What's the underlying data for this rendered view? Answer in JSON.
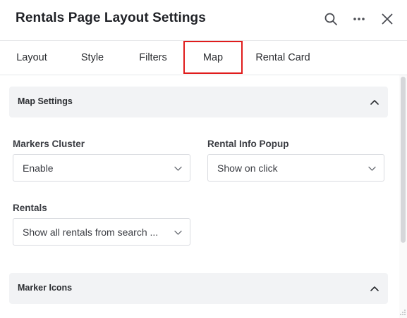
{
  "header": {
    "title": "Rentals Page Layout Settings",
    "icons": [
      "search-icon",
      "more-icon",
      "close-icon"
    ]
  },
  "tabs": [
    {
      "label": "Layout",
      "active": false
    },
    {
      "label": "Style",
      "active": false
    },
    {
      "label": "Filters",
      "active": false
    },
    {
      "label": "Map",
      "active": true
    },
    {
      "label": "Rental Card",
      "active": false
    }
  ],
  "sections": {
    "map_settings": {
      "title": "Map Settings",
      "expanded": true
    },
    "marker_icons": {
      "title": "Marker Icons",
      "expanded": true
    }
  },
  "fields": {
    "markers_cluster": {
      "label": "Markers Cluster",
      "value": "Enable"
    },
    "rental_info_popup": {
      "label": "Rental Info Popup",
      "value": "Show on click"
    },
    "rentals": {
      "label": "Rentals",
      "value": "Show all rentals from search ..."
    }
  },
  "colors": {
    "active_tab_outline": "#e01c1c",
    "section_background": "#f2f3f5",
    "border": "#d9dbe0"
  }
}
